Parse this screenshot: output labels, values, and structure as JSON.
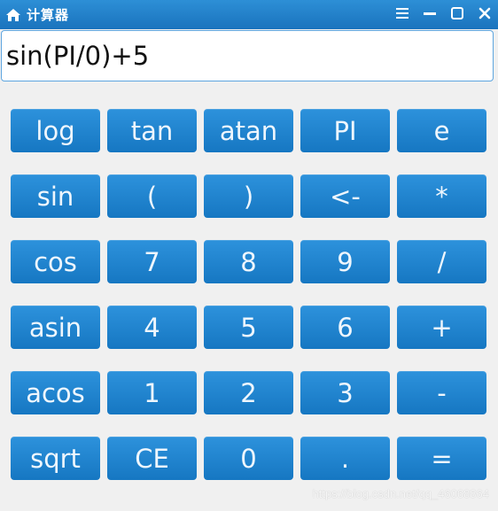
{
  "window": {
    "title": "计算器",
    "controls": [
      {
        "name": "menu-icon",
        "icon": "hamburger"
      },
      {
        "name": "minimize-icon",
        "icon": "minimize"
      },
      {
        "name": "maximize-icon",
        "icon": "maximize"
      },
      {
        "name": "close-icon",
        "icon": "close"
      }
    ]
  },
  "display": {
    "expression": "sin(PI/0)+5"
  },
  "keys": [
    "log",
    "tan",
    "atan",
    "PI",
    "e",
    "sin",
    "(",
    ")",
    "<-",
    "*",
    "cos",
    "7",
    "8",
    "9",
    "/",
    "asin",
    "4",
    "5",
    "6",
    "+",
    "acos",
    "1",
    "2",
    "3",
    "-",
    "sqrt",
    "CE",
    "0",
    ".",
    "="
  ],
  "key_names": [
    "key-log",
    "key-tan",
    "key-atan",
    "key-pi",
    "key-e",
    "key-sin",
    "key-open-paren",
    "key-close-paren",
    "key-backspace",
    "key-multiply",
    "key-cos",
    "key-7",
    "key-8",
    "key-9",
    "key-divide",
    "key-asin",
    "key-4",
    "key-5",
    "key-6",
    "key-plus",
    "key-acos",
    "key-1",
    "key-2",
    "key-3",
    "key-minus",
    "key-sqrt",
    "key-ce",
    "key-0",
    "key-decimal",
    "key-equals"
  ],
  "watermark": "https://blog.csdn.net/qq_46068864",
  "colors": {
    "accent": "#1a7fcf",
    "titlebar": "#1a73bd",
    "background": "#f0f0f0"
  }
}
